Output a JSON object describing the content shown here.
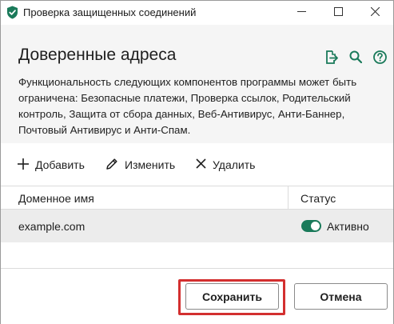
{
  "window": {
    "title": "Проверка защищенных соединений"
  },
  "header": {
    "title": "Доверенные адреса",
    "description": "Функциональность следующих компонентов программы может быть ограничена: Безопасные платежи, Проверка ссылок, Родительский контроль, Защита от сбора данных, Веб-Антивирус, Анти-Баннер, Почтовый Антивирус и Анти-Спам.",
    "icons": [
      "export-icon",
      "search-icon",
      "help-icon"
    ]
  },
  "toolbar": {
    "add_label": "Добавить",
    "edit_label": "Изменить",
    "delete_label": "Удалить"
  },
  "table": {
    "columns": [
      "Доменное имя",
      "Статус"
    ],
    "rows": [
      {
        "domain": "example.com",
        "status": "Активно",
        "enabled": true
      }
    ]
  },
  "footer": {
    "save_label": "Сохранить",
    "cancel_label": "Отмена"
  },
  "colors": {
    "accent": "#1a7a5a",
    "highlight": "#d32f2f",
    "header_bg": "#f5f5f5",
    "selected_row_bg": "#ececec"
  }
}
